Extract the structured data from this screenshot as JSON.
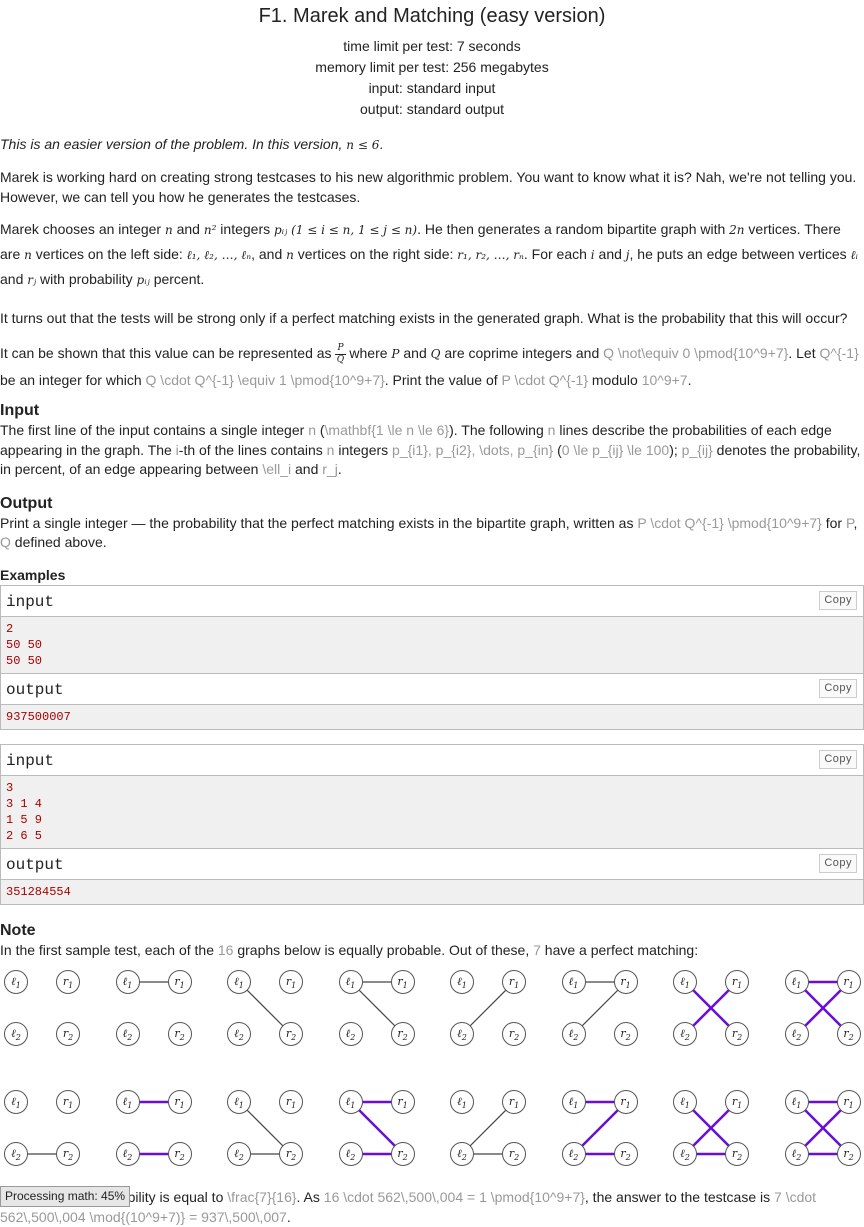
{
  "title": "F1. Marek and Matching (easy version)",
  "limits": {
    "time": "time limit per test: 7 seconds",
    "memory": "memory limit per test: 256 megabytes",
    "input": "input: standard input",
    "output": "output: standard output"
  },
  "statement": {
    "easy_note_prefix": "This is an easier version of the problem. In this version, ",
    "easy_note_math": "n ≤ 6.",
    "p1": "Marek is working hard on creating strong testcases to his new algorithmic problem. You want to know what it is? Nah, we're not telling you. However, we can tell you how he generates the testcases.",
    "p2_a": "Marek chooses an integer ",
    "p2_n": "n",
    "p2_b": " and ",
    "p2_n2": "n²",
    "p2_c": " integers ",
    "p2_pij": "pᵢⱼ (1 ≤ i ≤ n, 1 ≤ j ≤ n)",
    "p2_d": ". He then generates a random bipartite graph with ",
    "p2_2n": "2n",
    "p2_e": " vertices. There are ",
    "p2_f": " vertices on the left side: ",
    "p2_left": "ℓ₁, ℓ₂, …, ℓₙ",
    "p2_g": ", and ",
    "p2_h": " vertices on the right side: ",
    "p2_right": "r₁, r₂, …, rₙ",
    "p2_i": ". For each ",
    "p2_ivar": "i",
    "p2_j": " and ",
    "p2_jvar": "j",
    "p2_k": ", he puts an edge between vertices ",
    "p2_li": "ℓᵢ",
    "p2_l": " and ",
    "p2_rj": "rⱼ",
    "p2_m": " with probability ",
    "p2_pij2": "pᵢⱼ",
    "p2_end": " percent.",
    "p3": "It turns out that the tests will be strong only if a perfect matching exists in the generated graph. What is the probability that this will occur?",
    "p4_a": "It can be shown that this value can be represented as ",
    "p4_frac_num": "P",
    "p4_frac_den": "Q",
    "p4_b": " where ",
    "p4_P": "P",
    "p4_c": " and ",
    "p4_Q": "Q",
    "p4_d": " are coprime integers and ",
    "p4_tex1": "Q \\not\\equiv 0 \\pmod{10^9+7}",
    "p4_e": ". Let ",
    "p4_tex2": "Q^{-1}",
    "p4_f": " be an integer for which ",
    "p4_tex3": "Q \\cdot Q^{-1} \\equiv 1 \\pmod{10^9+7}",
    "p4_g": ". Print the value of ",
    "p4_tex4": "P \\cdot Q^{-1}",
    "p4_h": " modulo ",
    "p4_tex5": "10^9+7",
    "p4_end": "."
  },
  "input_section": {
    "title": "Input",
    "t1": "The first line of the input contains a single integer ",
    "x1": "n",
    "t2": " (",
    "x2": "\\mathbf{1 \\le n \\le 6}",
    "t3": "). The following ",
    "x3": "n",
    "t4": " lines describe the probabilities of each edge appearing in the graph. The ",
    "x4": "i",
    "t5": "-th of the lines contains ",
    "x5": "n",
    "t6": " integers ",
    "x6": "p_{i1}, p_{i2}, \\dots, p_{in}",
    "t7": " (",
    "x7": "0 \\le p_{ij} \\le 100",
    "t8": "); ",
    "x8": "p_{ij}",
    "t9": " denotes the probability, in percent, of an edge appearing between ",
    "x9": "\\ell_i",
    "t10": " and ",
    "x10": "r_j",
    "t11": "."
  },
  "output_section": {
    "title": "Output",
    "t1": "Print a single integer — the probability that the perfect matching exists in the bipartite graph, written as ",
    "x1": "P \\cdot Q^{-1} \\pmod{10^9+7}",
    "t2": " for ",
    "x2": "P",
    "t3": ", ",
    "x3": "Q",
    "t4": " defined above."
  },
  "examples": {
    "title": "Examples",
    "copy_label": "Copy",
    "input_label": "input",
    "output_label": "output",
    "cases": [
      {
        "input": "2\n50 50\n50 50",
        "output": "937500007"
      },
      {
        "input": "3\n3 1 4\n1 5 9\n2 6 5",
        "output": "351284554"
      }
    ]
  },
  "note": {
    "title": "Note",
    "t1": "In the first sample test, each of the ",
    "x1": "16",
    "t2": " graphs below is equally probable. Out of these, ",
    "x2": "7",
    "t3": " have a perfect matching:",
    "graphs": [
      {
        "edges": [],
        "matching": false
      },
      {
        "edges": [
          "11"
        ],
        "matching": false
      },
      {
        "edges": [
          "12"
        ],
        "matching": false
      },
      {
        "edges": [
          "11",
          "12"
        ],
        "matching": false
      },
      {
        "edges": [
          "21"
        ],
        "matching": false
      },
      {
        "edges": [
          "11",
          "21"
        ],
        "matching": false
      },
      {
        "edges": [
          "12",
          "21"
        ],
        "matching": true
      },
      {
        "edges": [
          "11",
          "12",
          "21"
        ],
        "matching": true
      },
      {
        "edges": [
          "22"
        ],
        "matching": false
      },
      {
        "edges": [
          "11",
          "22"
        ],
        "matching": true
      },
      {
        "edges": [
          "12",
          "22"
        ],
        "matching": false
      },
      {
        "edges": [
          "11",
          "12",
          "22"
        ],
        "matching": true
      },
      {
        "edges": [
          "21",
          "22"
        ],
        "matching": false
      },
      {
        "edges": [
          "11",
          "21",
          "22"
        ],
        "matching": true
      },
      {
        "edges": [
          "12",
          "21",
          "22"
        ],
        "matching": true
      },
      {
        "edges": [
          "11",
          "12",
          "21",
          "22"
        ],
        "matching": true
      }
    ],
    "matching_color": "#6a0dd8",
    "edge_color": "#444444",
    "c1": "Therefore, the probability is equal to ",
    "cx1": "\\frac{7}{16}",
    "c2": ". As ",
    "cx2": "16 \\cdot 562\\,500\\,004 = 1 \\pmod{10^9+7}",
    "c3": ", the answer to the testcase is ",
    "cx3": "7 \\cdot 562\\,500\\,004 \\mod{(10^9+7)} = 937\\,500\\,007",
    "c4": "."
  },
  "math_loader": "Processing math: 45%"
}
